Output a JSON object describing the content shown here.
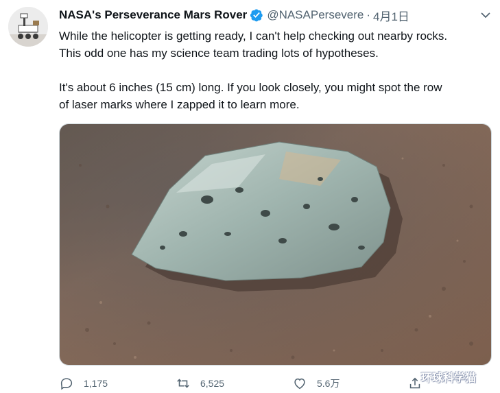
{
  "tweet": {
    "author": {
      "display_name": "NASA's Perseverance Mars Rover",
      "handle": "@NASAPersevere",
      "separator": "·",
      "date": "4月1日",
      "verified_icon": "verified-badge-icon"
    },
    "text": {
      "line1": "While the helicopter is getting ready, I can't help checking out nearby rocks.",
      "line2": "This odd one has my science team trading lots of hypotheses.",
      "line3": "It's about 6 inches (15 cm) long. If you look closely, you might spot the row",
      "line4": "of laser marks where I zapped it to learn more."
    },
    "media": {
      "icon": "photo-of-green-rock-on-mars"
    },
    "actions": {
      "replies": "1,175",
      "retweets": "6,525",
      "likes": "5.6万",
      "share_icon": "share-icon"
    },
    "watermark": "环球科学猫"
  },
  "colors": {
    "text_primary": "#0f1419",
    "text_secondary": "#536471",
    "verified": "#1d9bf0",
    "ground": "#8a6b58",
    "rock": "#9fb4ae"
  }
}
